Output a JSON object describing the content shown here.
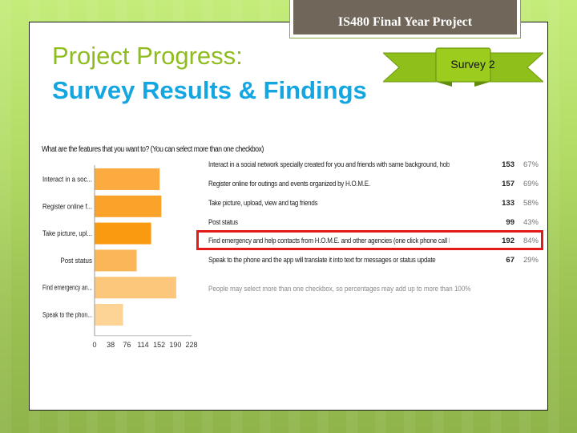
{
  "slide": {
    "header": "IS480 Final Year Project",
    "title_line1": "Project Progress:",
    "title_line2": "Survey Results & Findings",
    "ribbon_label": "Survey 2",
    "colors": {
      "title1": "#8fbc1f",
      "title2": "#13a6e0",
      "header_bg": "#70665a",
      "ribbon": "#8fbf1a",
      "highlight": "#e21a1a"
    }
  },
  "chart_data": {
    "type": "bar",
    "orientation": "horizontal",
    "title": "What are the features that you want to? (You can select more than one checkbox)",
    "categories": [
      "Interact in a soc...",
      "Register online f...",
      "Take picture, upl...",
      "Post status",
      "Find emergency an...",
      "Speak to the phon..."
    ],
    "values": [
      153,
      157,
      133,
      99,
      192,
      67
    ],
    "bar_colors": [
      "#fbab3f",
      "#faa22a",
      "#f99a10",
      "#fbb658",
      "#fcc77a",
      "#fdd496"
    ],
    "xticks": [
      0,
      38,
      76,
      114,
      152,
      190,
      228
    ],
    "xlim": [
      0,
      228
    ],
    "xlabel": "",
    "ylabel": "",
    "grid": false
  },
  "results_table": {
    "rows": [
      {
        "label": "Interact in a social network specially created for you and friends with same background, hobbies, jobs, nationality, or etc",
        "count": "153",
        "percent": "67%"
      },
      {
        "label": "Register online for outings and events organized by H.O.M.E.",
        "count": "157",
        "percent": "69%"
      },
      {
        "label": "Take picture, upload, view and tag friends",
        "count": "133",
        "percent": "58%"
      },
      {
        "label": "Post status",
        "count": "99",
        "percent": "43%"
      },
      {
        "label": "Find emergency and help contacts from H.O.M.E. and other agencies (one click phone call button)",
        "count": "192",
        "percent": "84%"
      },
      {
        "label": "Speak to the phone and the app will translate it into text for messages or status update",
        "count": "67",
        "percent": "29%"
      }
    ],
    "note": "People may select more than one checkbox, so percentages may add up to more than 100%",
    "highlighted_row": 4
  }
}
